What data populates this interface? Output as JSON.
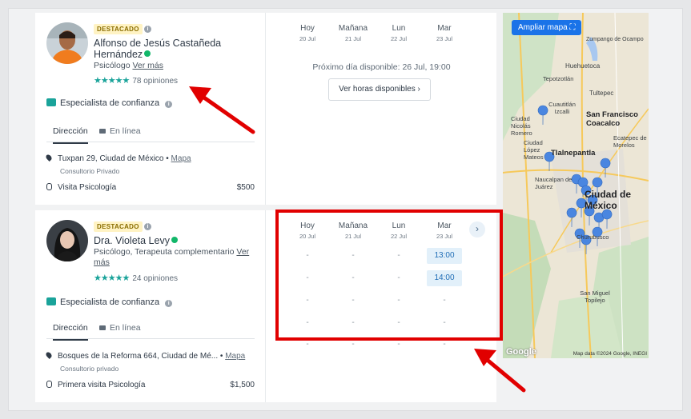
{
  "cards": [
    {
      "badge": "DESTACADO",
      "name_line1": "Alfonso de Jesús Castañeda",
      "name_line2": "Hernández",
      "specialty": "Psicólogo",
      "ver_mas": "Ver más",
      "opinions": "78 opiniones",
      "trust": "Especialista de confianza",
      "tab_address": "Dirección",
      "tab_online": "En línea",
      "address": "Tuxpan 29, Ciudad de México •",
      "map_link": "Mapa",
      "office": "Consultorio Privado",
      "visit": "Visita Psicología",
      "price": "$500",
      "days": [
        {
          "day": "Hoy",
          "date": "20 Jul"
        },
        {
          "day": "Mañana",
          "date": "21 Jul"
        },
        {
          "day": "Lun",
          "date": "22 Jul"
        },
        {
          "day": "Mar",
          "date": "23 Jul"
        }
      ],
      "next_available": "Próximo día disponible: 26 Jul, 19:00",
      "hours_button": "Ver horas disponibles"
    },
    {
      "badge": "DESTACADO",
      "name_line1": "Dra. Violeta Levy",
      "specialty": "Psicólogo, Terapeuta complementario",
      "ver_mas": "Ver",
      "ver_mas_2": "más",
      "opinions": "24 opiniones",
      "trust": "Especialista de confianza",
      "tab_address": "Dirección",
      "tab_online": "En línea",
      "address": "Bosques de la Reforma 664, Ciudad de Mé... •",
      "map_link": "Mapa",
      "office": "Consultorio privado",
      "visit": "Primera visita Psicología",
      "price": "$1,500",
      "days": [
        {
          "day": "Hoy",
          "date": "20 Jul"
        },
        {
          "day": "Mañana",
          "date": "21 Jul"
        },
        {
          "day": "Lun",
          "date": "22 Jul"
        },
        {
          "day": "Mar",
          "date": "23 Jul"
        }
      ],
      "slot_rows": [
        [
          "-",
          "-",
          "-",
          "13:00"
        ],
        [
          "-",
          "-",
          "-",
          "14:00"
        ],
        [
          "-",
          "-",
          "-",
          "-"
        ],
        [
          "-",
          "-",
          "-",
          "-"
        ],
        [
          "-",
          "-",
          "-",
          "-"
        ]
      ],
      "next_arrow": "›"
    }
  ],
  "map": {
    "button": "Ampliar mapa",
    "labels": [
      "Zumpango de Ocampo",
      "Huehuetoca",
      "Tepotzotlán",
      "Tultepec",
      "Cuautitlán Izcalli",
      "San Francisco Coacalco",
      "Ciudad Nicolás Romero",
      "Ciudad López Mateos",
      "Tlalnepantla",
      "Ecatepec de Morelos",
      "Naucalpan de Juárez",
      "Ciudad de México",
      "Churubusco",
      "San Miguel Topilejo"
    ],
    "credit": "Map data ©2024 Google, INEGI",
    "google": "Google",
    "accent": "#1a73e8"
  }
}
